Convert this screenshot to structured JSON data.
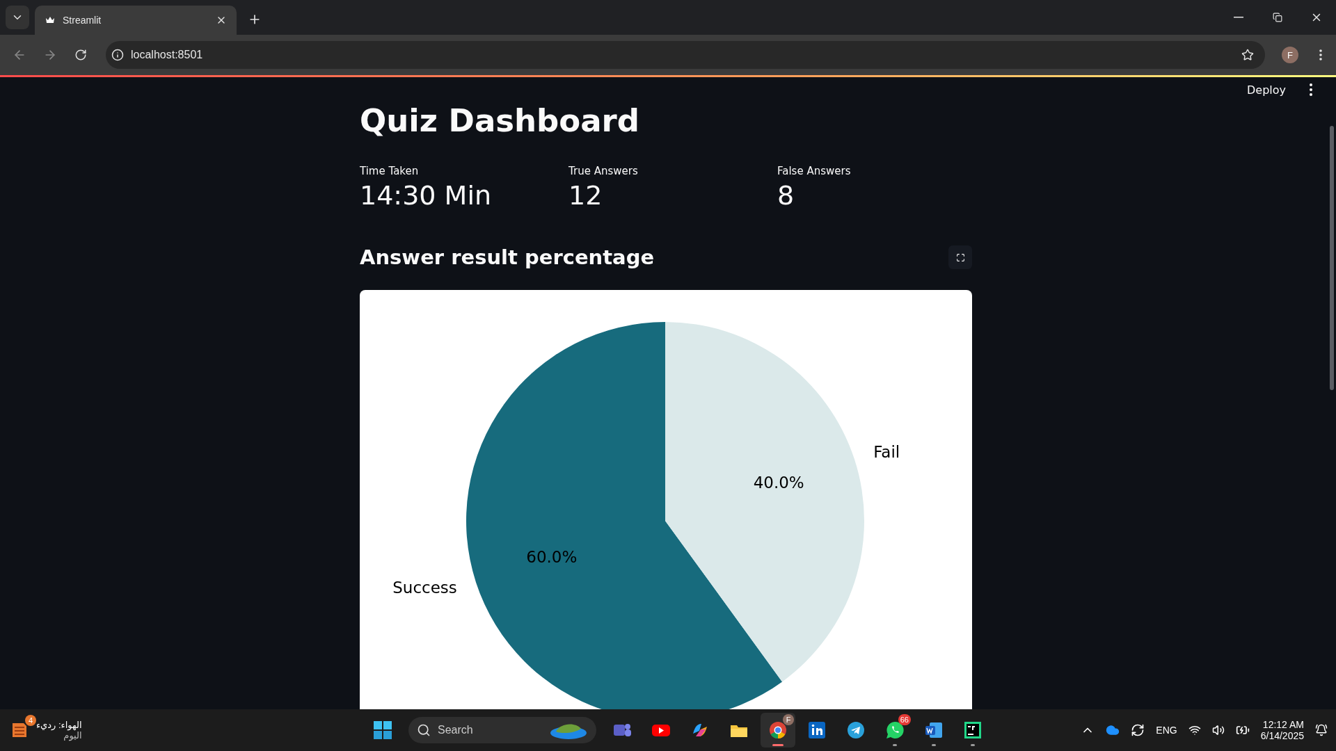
{
  "browser": {
    "tab": {
      "title": "Streamlit",
      "selected": true
    },
    "address": "localhost:8501",
    "profile": "F"
  },
  "app": {
    "toolbar": {
      "deploy": "Deploy"
    },
    "title": "Quiz Dashboard",
    "metrics": [
      {
        "label": "Time Taken",
        "value": "14:30 Min"
      },
      {
        "label": "True Answers",
        "value": "12"
      },
      {
        "label": "False Answers",
        "value": "8"
      }
    ],
    "chart_heading": "Answer result percentage",
    "chart_data": {
      "type": "pie",
      "categories": [
        "Success",
        "Fail"
      ],
      "values": [
        60,
        40
      ],
      "value_labels": [
        "60.0%",
        "40.0%"
      ]
    }
  },
  "taskbar": {
    "weather": {
      "badge": "4",
      "title": "الهواء: رديء",
      "subtitle": "اليوم"
    },
    "search": {
      "placeholder": "Search"
    },
    "apps": [
      {
        "kind": "teams",
        "running": false,
        "selected": false
      },
      {
        "kind": "youtube",
        "running": false,
        "selected": false
      },
      {
        "kind": "copilot",
        "running": false,
        "selected": false
      },
      {
        "kind": "explorer",
        "running": false,
        "selected": false
      },
      {
        "kind": "chrome",
        "badge": "F",
        "running": true,
        "selected": true
      },
      {
        "kind": "linkedin",
        "running": false,
        "selected": false
      },
      {
        "kind": "telegram",
        "running": false,
        "selected": false
      },
      {
        "kind": "whatsapp",
        "badge": "66",
        "running": true,
        "selected": false
      },
      {
        "kind": "word",
        "running": true,
        "selected": false
      },
      {
        "kind": "pycharm",
        "running": true,
        "selected": false
      }
    ],
    "language": "ENG",
    "time": "12:12 AM",
    "date": "6/14/2025"
  }
}
